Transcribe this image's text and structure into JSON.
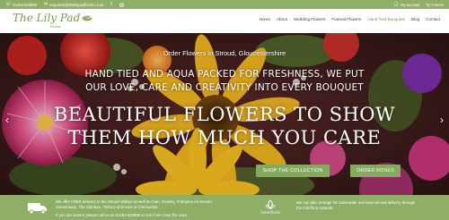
{
  "topbar": {
    "phone": "01453 840900",
    "email": "enquiries@thelilypadflorist.co.uk",
    "account": "My account",
    "cart": "0 items"
  },
  "header": {
    "logo_text": "The Lily Pad",
    "logo_sub": "Florist",
    "nav": [
      {
        "label": "Home"
      },
      {
        "label": "About"
      },
      {
        "label": "Wedding Flowers"
      },
      {
        "label": "Funeral Flowers"
      },
      {
        "label": "Hand Tied Bouquets"
      },
      {
        "label": "Blog"
      },
      {
        "label": "Contact"
      }
    ],
    "active_index": 4
  },
  "hero": {
    "subtitle": "Order Flowers in Stroud, Gloucestershire",
    "line1": "Hand tied and aqua packed for freshness, we put",
    "line2": "our love, care and creativity into every bouquet",
    "title1": "Beautiful Flowers to Show",
    "title2": "Them How Much You Care",
    "btn_shop": "SHOP THE COLLECTION",
    "btn_order": "ORDER ROSES"
  },
  "strip": {
    "delivery_text": "We offer FREE delivery to the Stroud Valleys as well as Cam, Dursley, Frampton on Severn, Stonehouse, The Stanleys, Tetbury and most of Cirencester.",
    "phone_text": "If you are unsure please call us on 01453 840900 to see if we cover the area.",
    "interflora_label": "Interflora",
    "interflora_text": "We can also arrange for nationwide and international delivery through the Interflora network."
  },
  "colors": {
    "brand_green": "#8fae66",
    "button_green": "#86a95e",
    "logo_green": "#7c9a52"
  },
  "icons": {
    "phone": "phone-icon",
    "email": "email-icon",
    "facebook": "facebook-icon",
    "instagram": "instagram-icon",
    "account": "user-icon",
    "cart": "cart-icon",
    "van": "delivery-van-icon"
  }
}
